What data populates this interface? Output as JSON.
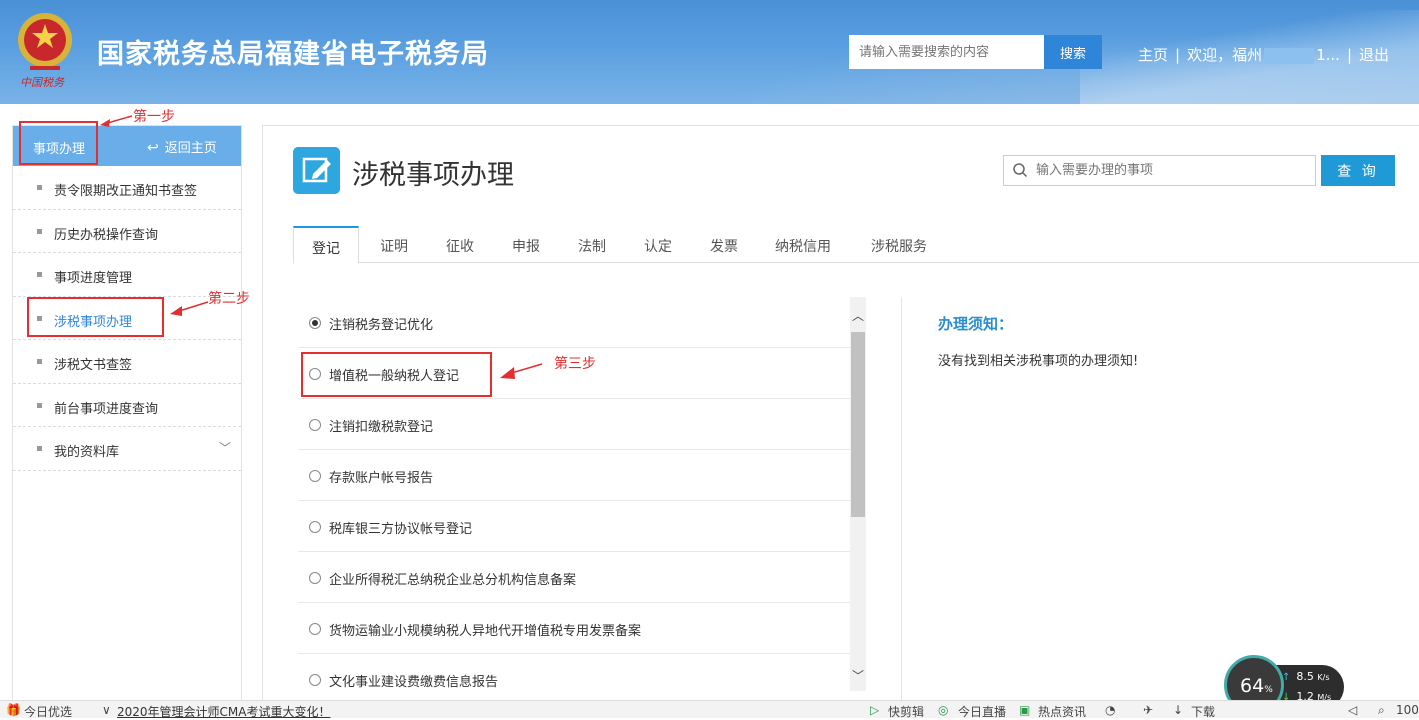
{
  "header": {
    "site_title": "国家税务总局福建省电子税务局",
    "search_placeholder": "请输入需要搜索的内容",
    "search_button": "搜索",
    "nav_home": "主页",
    "nav_sep": "|",
    "welcome": "欢迎，福州",
    "welcome_tail": "1...",
    "logout": "退出",
    "emblem_text": "中国税务"
  },
  "sidebar": {
    "title": "事项办理",
    "back_home": "返回主页",
    "items": [
      {
        "label": "责令限期改正通知书查签"
      },
      {
        "label": "历史办税操作查询"
      },
      {
        "label": "事项进度管理"
      },
      {
        "label": "涉税事项办理"
      },
      {
        "label": "涉税文书查签"
      },
      {
        "label": "前台事项进度查询"
      },
      {
        "label": "我的资料库"
      }
    ]
  },
  "main": {
    "page_title": "涉税事项办理",
    "item_search_placeholder": "输入需要办理的事项",
    "query_button": "查 询",
    "tabs": [
      {
        "label": "登记"
      },
      {
        "label": "证明"
      },
      {
        "label": "征收"
      },
      {
        "label": "申报"
      },
      {
        "label": "法制"
      },
      {
        "label": "认定"
      },
      {
        "label": "发票"
      },
      {
        "label": "纳税信用"
      },
      {
        "label": "涉税服务"
      }
    ],
    "options": [
      {
        "label": "注销税务登记优化",
        "selected": true
      },
      {
        "label": "增值税一般纳税人登记",
        "selected": false
      },
      {
        "label": "注销扣缴税款登记",
        "selected": false
      },
      {
        "label": "存款账户帐号报告",
        "selected": false
      },
      {
        "label": "税库银三方协议帐号登记",
        "selected": false
      },
      {
        "label": "企业所得税汇总纳税企业总分机构信息备案",
        "selected": false
      },
      {
        "label": "货物运输业小规模纳税人异地代开增值税专用发票备案",
        "selected": false
      },
      {
        "label": "文化事业建设费缴费信息报告",
        "selected": false
      }
    ],
    "notice_title": "办理须知：",
    "notice_text": "没有找到相关涉税事项的办理须知!"
  },
  "annotations": {
    "step1": "第一步",
    "step2": "第二步",
    "step3": "第三步"
  },
  "widget": {
    "percent": "64",
    "percent_unit": "%",
    "upload": "8.5",
    "upload_unit": "K/s",
    "download": "1.2",
    "download_unit": "M/s"
  },
  "taskbar": {
    "today_pick": "今日优选",
    "news": "2020年管理会计师CMA考试重大变化！",
    "clip": "快剪辑",
    "live": "今日直播",
    "hot": "热点资讯",
    "download": "下载",
    "zoom": "100"
  },
  "colors": {
    "header_blue": "#5a9fe0",
    "accent": "#1f9ad6",
    "annotation_red": "#e03030"
  }
}
